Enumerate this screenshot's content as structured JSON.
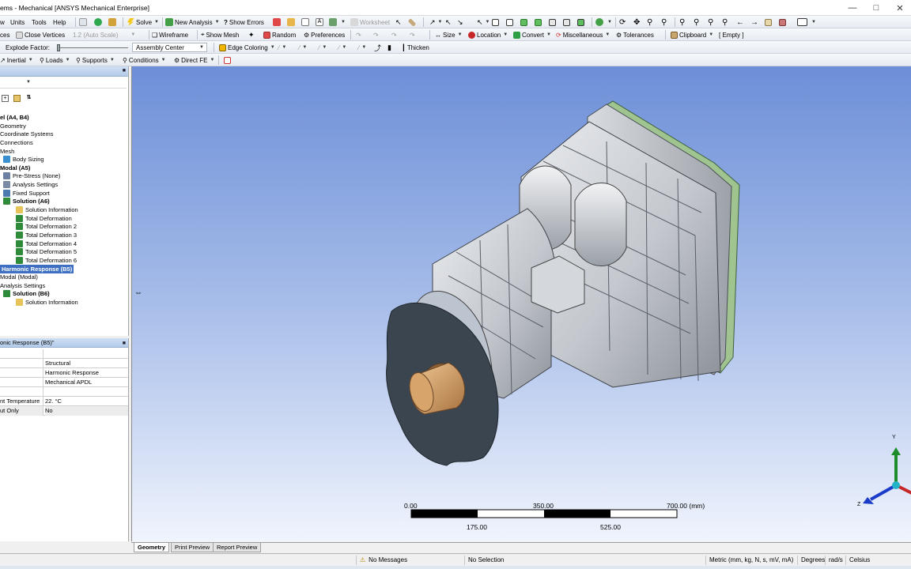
{
  "window": {
    "title": "ems - Mechanical [ANSYS Mechanical Enterprise]"
  },
  "menu": {
    "view": "w",
    "units": "Units",
    "tools": "Tools",
    "help": "Help",
    "solve": "Solve",
    "new_analysis": "New Analysis",
    "show_errors": "Show Errors",
    "worksheet": "Worksheet"
  },
  "toolbar2": {
    "close_vertices_prefix": "ces",
    "close_vertices": "Close Vertices",
    "auto_scale": "1.2 (Auto Scale)",
    "wireframe": "Wireframe",
    "show_mesh": "Show Mesh",
    "random": "Random",
    "preferences": "Preferences",
    "size": "Size",
    "location": "Location",
    "convert": "Convert",
    "miscellaneous": "Miscellaneous",
    "tolerances": "Tolerances",
    "clipboard": "Clipboard",
    "empty": "[ Empty ]"
  },
  "toolbar3": {
    "explode_factor": "Explode Factor:",
    "assembly_center": "Assembly Center",
    "edge_coloring": "Edge Coloring",
    "thicken": "Thicken"
  },
  "toolbar4": {
    "inertial": "Inertial",
    "loads": "Loads",
    "supports": "Supports",
    "conditions": "Conditions",
    "direct_fe": "Direct FE"
  },
  "tree": {
    "items": [
      {
        "label": "el (A4, B4)",
        "bold": true
      },
      {
        "label": "Geometry",
        "bold": false
      },
      {
        "label": "Coordinate Systems",
        "bold": false
      },
      {
        "label": "Connections",
        "bold": false
      },
      {
        "label": "Mesh",
        "bold": false
      },
      {
        "label": "Body Sizing",
        "bold": false
      },
      {
        "label": "Modal (A5)",
        "bold": true
      },
      {
        "label": "Pre-Stress (None)",
        "bold": false
      },
      {
        "label": "Analysis Settings",
        "bold": false
      },
      {
        "label": "Fixed Support",
        "bold": false
      },
      {
        "label": "Solution (A6)",
        "bold": true
      },
      {
        "label": "Solution Information",
        "bold": false
      },
      {
        "label": "Total Deformation",
        "bold": false
      },
      {
        "label": "Total Deformation 2",
        "bold": false
      },
      {
        "label": "Total Deformation 3",
        "bold": false
      },
      {
        "label": "Total Deformation 4",
        "bold": false
      },
      {
        "label": "Total Deformation 5",
        "bold": false
      },
      {
        "label": "Total Deformation 6",
        "bold": false
      },
      {
        "label": "Harmonic Response (B5)",
        "bold": true
      },
      {
        "label": "Modal (Modal)",
        "bold": false
      },
      {
        "label": "Analysis Settings",
        "bold": false
      },
      {
        "label": "Solution (B6)",
        "bold": true
      },
      {
        "label": "Solution Information",
        "bold": false
      }
    ]
  },
  "details": {
    "header": "onic Response (B5)\"",
    "rows": [
      {
        "key": "",
        "value": ""
      },
      {
        "key": "",
        "value": "Structural"
      },
      {
        "key": "",
        "value": "Harmonic Response"
      },
      {
        "key": "",
        "value": "Mechanical APDL"
      },
      {
        "key": "",
        "value": ""
      },
      {
        "key": "nt Temperature",
        "value": "22. °C"
      },
      {
        "key": "ut Only",
        "value": "No"
      }
    ]
  },
  "scale": {
    "top_labels": [
      "0.00",
      "350.00",
      "700.00 (mm)"
    ],
    "bottom_labels": [
      "175.00",
      "525.00"
    ]
  },
  "triad": {
    "y": "Y",
    "z": "Z"
  },
  "tabs": {
    "geometry": "Geometry",
    "print_preview": "Print Preview",
    "report_preview": "Report Preview"
  },
  "status": {
    "messages": "No Messages",
    "selection": "No Selection",
    "units": "Metric (mm, kg, N, s, mV, mA)",
    "degrees": "Degrees",
    "rads": "rad/s",
    "celsius": "Celsius"
  },
  "colors": {
    "viewport_top": "#6d8fd8",
    "viewport_bottom": "#f0f4fd",
    "selected": "#3f6fc0",
    "part_gray": "#c9ccd1",
    "hub_dark": "#3b4550",
    "shaft_bronze": "#c98f55"
  }
}
